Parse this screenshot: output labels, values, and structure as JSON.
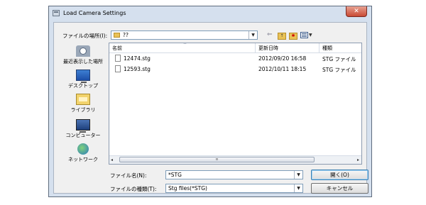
{
  "window": {
    "title": "Load Camera Settings",
    "close_glyph": "✕"
  },
  "toolbar": {
    "look_in_label": "ファイルの場所(I):",
    "look_in_value": "??",
    "icons": [
      "back-arrow-icon",
      "up-folder-icon",
      "new-folder-icon",
      "views-menu-icon"
    ]
  },
  "places": [
    {
      "label": "最近表示した場所",
      "icon": "recent-places-icon"
    },
    {
      "label": "デスクトップ",
      "icon": "desktop-icon"
    },
    {
      "label": "ライブラリ",
      "icon": "libraries-icon"
    },
    {
      "label": "コンピューター",
      "icon": "computer-icon"
    },
    {
      "label": "ネットワーク",
      "icon": "network-icon"
    }
  ],
  "file_list": {
    "columns": [
      "名前",
      "更新日時",
      "種類"
    ],
    "rows": [
      {
        "name": "12474.stg",
        "date": "2012/09/20 16:58",
        "type": "STG ファイル"
      },
      {
        "name": "12593.stg",
        "date": "2012/10/11 18:15",
        "type": "STG ファイル"
      }
    ]
  },
  "file_name": {
    "label": "ファイル名(N):",
    "value": "*STG"
  },
  "file_type": {
    "label": "ファイルの種類(T):",
    "value": "Stg files(*STG)"
  },
  "buttons": {
    "open": "開く(O)",
    "cancel": "キャンセル"
  },
  "colors": {
    "title_bar": "#d5e0ee",
    "close_button": "#c94a34",
    "client_bg": "#f0f0f0"
  }
}
